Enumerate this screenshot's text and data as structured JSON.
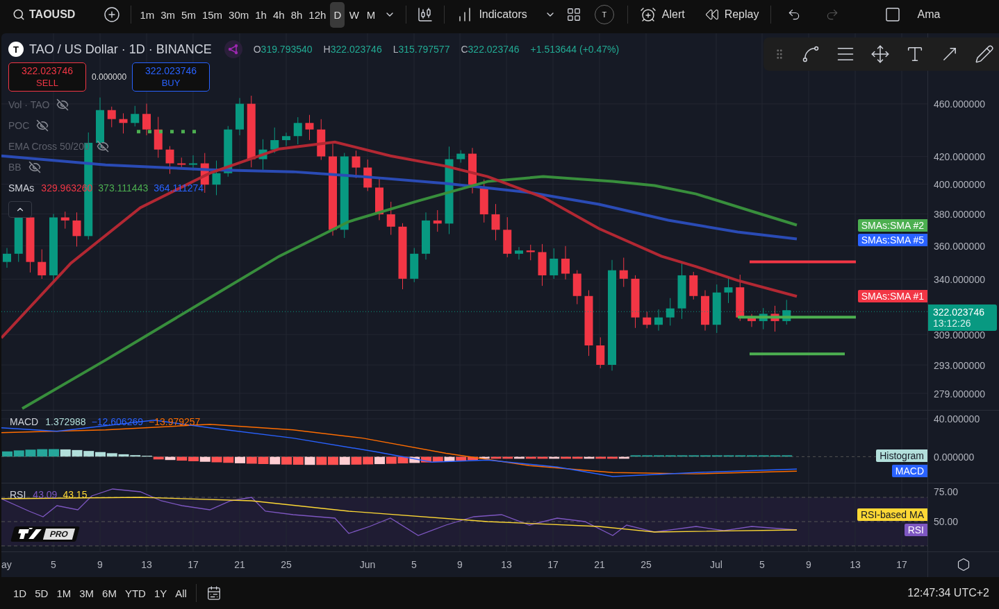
{
  "toolbar": {
    "symbol": "TAOUSD",
    "intervals": [
      {
        "label": "1m",
        "selected": false
      },
      {
        "label": "3m",
        "selected": false
      },
      {
        "label": "5m",
        "selected": false
      },
      {
        "label": "15m",
        "selected": false
      },
      {
        "label": "30m",
        "selected": false
      },
      {
        "label": "1h",
        "selected": false
      },
      {
        "label": "4h",
        "selected": false
      },
      {
        "label": "8h",
        "selected": false
      },
      {
        "label": "12h",
        "selected": false
      },
      {
        "label": "D",
        "selected": true
      },
      {
        "label": "W",
        "selected": false
      },
      {
        "label": "M",
        "selected": false
      }
    ],
    "indicators_label": "Indicators",
    "avatar_letter": "T",
    "alert_label": "Alert",
    "replay_label": "Replay",
    "cut_label": "Ama"
  },
  "legend": {
    "logo_letter": "T",
    "title": "TAO / US Dollar · 1D · BINANCE",
    "ohlc": [
      {
        "key": "O",
        "value": "319.793540"
      },
      {
        "key": "H",
        "value": "322.023746"
      },
      {
        "key": "L",
        "value": "315.797577"
      },
      {
        "key": "C",
        "value": "322.023746"
      }
    ],
    "change": "+1.513644 (+0.47%)"
  },
  "trade": {
    "sell_price": "322.023746",
    "sell_label": "SELL",
    "spread": "0.000000",
    "buy_price": "322.023746",
    "buy_label": "BUY"
  },
  "indicators": [
    {
      "name": "Vol · TAO",
      "hidden": true
    },
    {
      "name": "POC",
      "hidden": true
    },
    {
      "name": "EMA Cross 50/200",
      "hidden": true
    },
    {
      "name": "BB",
      "hidden": true
    },
    {
      "name": "SMAs",
      "hidden": false,
      "values": [
        {
          "text": "329.963260",
          "color": "#f23645"
        },
        {
          "text": "373.111443",
          "color": "#4caf50"
        },
        {
          "text": "364.111274",
          "color": "#2962ff"
        }
      ]
    }
  ],
  "price_axis": {
    "labels": [
      "460.000000",
      "420.000000",
      "400.000000",
      "380.000000",
      "360.000000",
      "340.000000",
      "309.000000",
      "293.000000",
      "279.000000"
    ],
    "current_price": "322.023746",
    "countdown": "13:12:26"
  },
  "series_tags": [
    {
      "label": "SMAs:SMA #2",
      "color": "#4caf50"
    },
    {
      "label": "SMAs:SMA #5",
      "color": "#2962ff"
    },
    {
      "label": "SMAs:SMA #1",
      "color": "#f23645"
    }
  ],
  "macd": {
    "name": "MACD",
    "values": [
      {
        "text": "1.372988",
        "color": "#b2dfdb"
      },
      {
        "text": "−12.606269",
        "color": "#2962ff"
      },
      {
        "text": "−13.979257",
        "color": "#ff6d00"
      }
    ],
    "axis_labels": [
      "40.000000",
      "0.000000"
    ],
    "tags": [
      {
        "label": "Histogram",
        "color": "#b2dfdb"
      },
      {
        "label": "MACD",
        "color": "#2962ff"
      }
    ]
  },
  "rsi": {
    "name": "RSI",
    "values": [
      {
        "text": "43.09",
        "color": "#7e57c2"
      },
      {
        "text": "43.15",
        "color": "#fdd835"
      }
    ],
    "axis_labels": [
      "75.00",
      "50.00"
    ],
    "tags": [
      {
        "label": "RSI-based MA",
        "color": "#fdd835"
      },
      {
        "label": "RSI",
        "color": "#7e57c2"
      }
    ]
  },
  "logo_badge": "PRO",
  "time_axis": [
    "ay",
    "5",
    "9",
    "13",
    "17",
    "21",
    "25",
    "Jun",
    "5",
    "9",
    "13",
    "17",
    "21",
    "25",
    "Jul",
    "5",
    "9",
    "13",
    "17"
  ],
  "bottom_bar": {
    "ranges": [
      "1D",
      "5D",
      "1M",
      "3M",
      "6M",
      "YTD",
      "1Y",
      "All"
    ],
    "clock": "12:47:34 UTC+2"
  }
}
